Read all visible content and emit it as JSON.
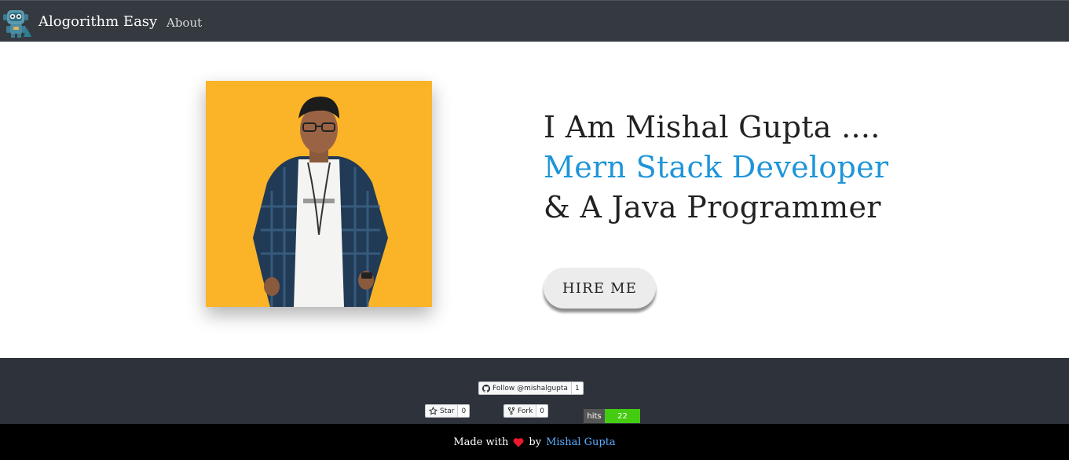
{
  "navbar": {
    "brand": "Alogorithm Easy",
    "logo_icon": "robot-logo-icon",
    "links": [
      {
        "label": "About"
      }
    ]
  },
  "hero": {
    "photo_icon": "profile-photo",
    "photo_bg": "#fbb328",
    "line1": "I Am Mishal Gupta ....",
    "line2": "Mern Stack Developer",
    "line3": "& A Java Programmer",
    "accent_color": "#1e95d8",
    "cta_label": "HIRE ME"
  },
  "widgets": {
    "follow": {
      "label": "Follow @mishalgupta",
      "count": "1",
      "icon": "github-icon"
    },
    "star": {
      "label": "Star",
      "count": "0",
      "icon": "star-icon"
    },
    "fork": {
      "label": "Fork",
      "count": "0",
      "icon": "fork-icon"
    },
    "hits": {
      "label": "hits",
      "count": "22"
    }
  },
  "footer": {
    "made_with": "Made with",
    "heart_icon": "heart-icon",
    "by": "by",
    "author": "Mishal Gupta"
  }
}
